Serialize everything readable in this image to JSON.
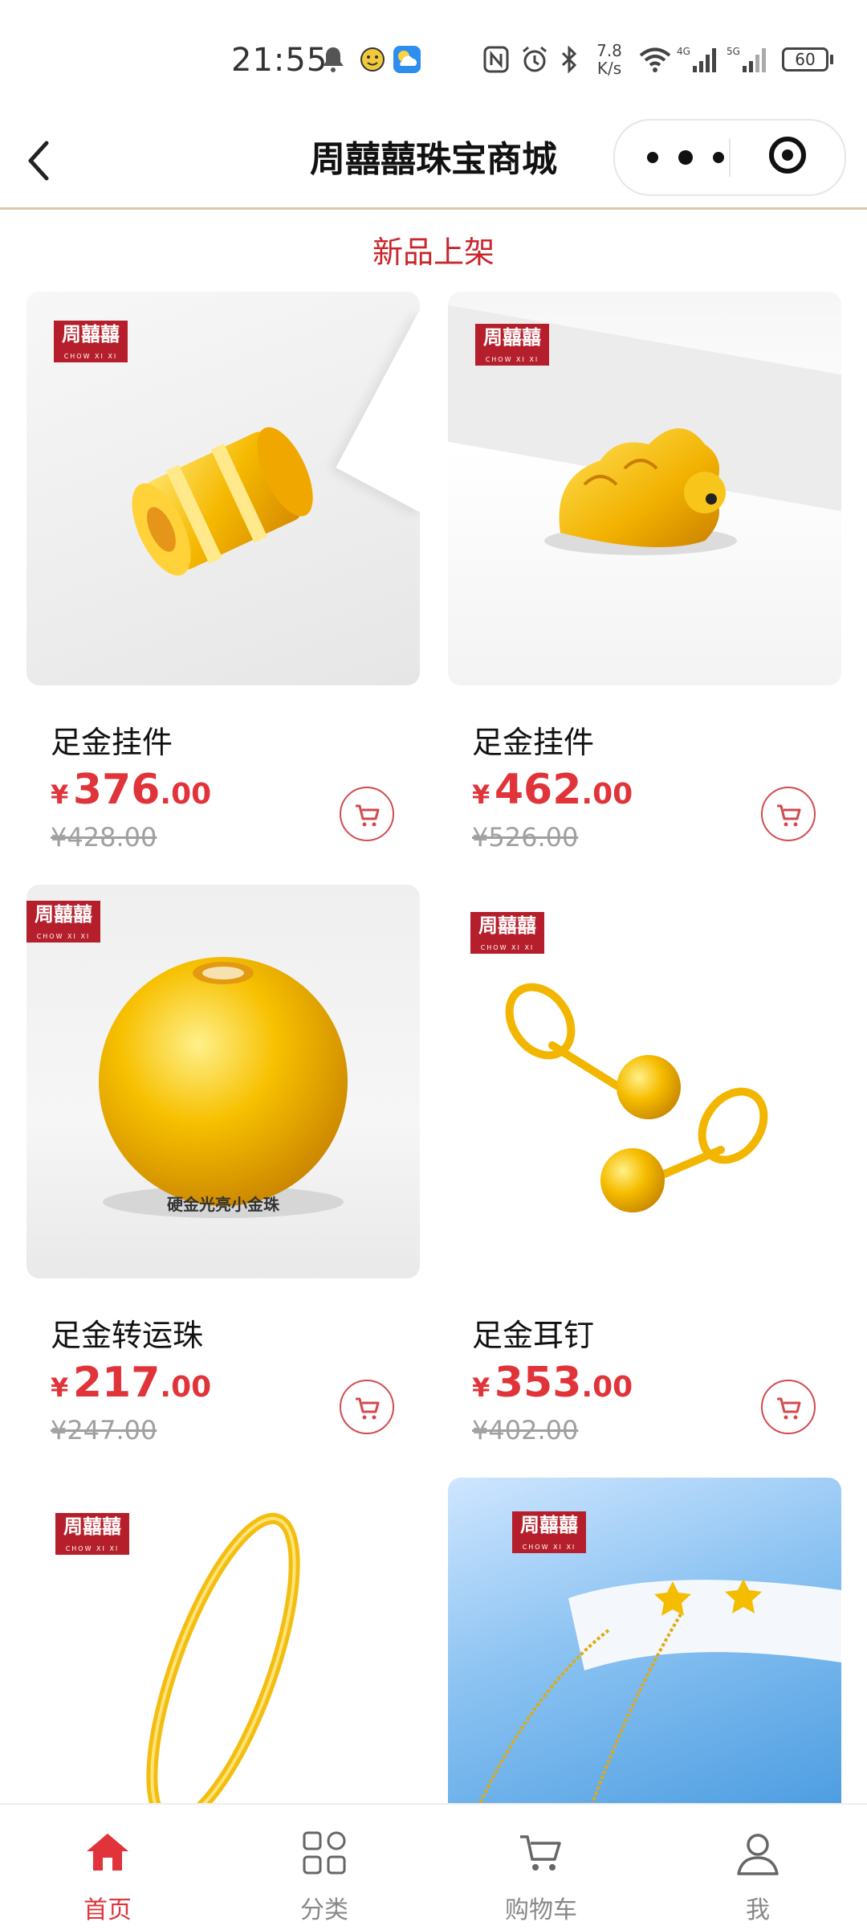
{
  "status_bar": {
    "time": "21:55",
    "net_speed": "7.8\nK/s",
    "battery": "60"
  },
  "nav": {
    "title": "周囍囍珠宝商城"
  },
  "section": {
    "title": "新品上架"
  },
  "brand": {
    "name": "周囍囍",
    "sub": "CHOW XI XI"
  },
  "products": [
    {
      "name": "足金挂件",
      "price_symbol": "¥",
      "price_int": "376",
      "price_dec": ".00",
      "original_price": "¥428.00"
    },
    {
      "name": "足金挂件",
      "price_symbol": "¥",
      "price_int": "462",
      "price_dec": ".00",
      "original_price": "¥526.00"
    },
    {
      "name": "足金转运珠",
      "price_symbol": "¥",
      "price_int": "217",
      "price_dec": ".00",
      "original_price": "¥247.00",
      "image_caption": "硬金光亮小金珠"
    },
    {
      "name": "足金耳钉",
      "price_symbol": "¥",
      "price_int": "353",
      "price_dec": ".00",
      "original_price": "¥402.00"
    }
  ],
  "tabbar": {
    "items": [
      {
        "label": "首页",
        "icon": "home-icon",
        "active": true
      },
      {
        "label": "分类",
        "icon": "category-icon",
        "active": false
      },
      {
        "label": "购物车",
        "icon": "cart-icon",
        "active": false
      },
      {
        "label": "我",
        "icon": "user-icon",
        "active": false
      }
    ]
  },
  "colors": {
    "accent": "#e0343a",
    "brand_red": "#b51f2b",
    "gold": "#f5c22a"
  }
}
